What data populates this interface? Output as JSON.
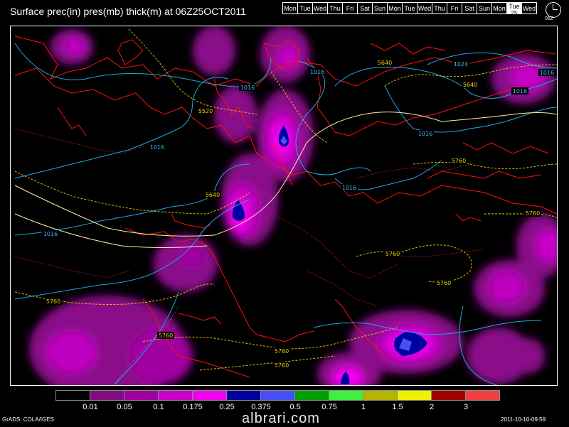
{
  "title": "Surface prec(in) pres(mb) thick(m) at 06Z25OCT2011",
  "days": [
    "Mon",
    "Tue",
    "Wed",
    "Thu",
    "Fri",
    "Sat",
    "Sun",
    "Mon",
    "Tue",
    "Wed",
    "Thu",
    "Fri",
    "Sat",
    "Sun",
    "Mon",
    "Tue",
    "Wed"
  ],
  "current_day_index": 15,
  "current_day_number": "25",
  "clock_label": "06Z",
  "legend": {
    "colors": [
      "#000000",
      "#7f0f7f",
      "#a000a0",
      "#c800c8",
      "#f000f0",
      "#0000a0",
      "#4650f5",
      "#00a000",
      "#40f040",
      "#b4b400",
      "#f0f000",
      "#a00000",
      "#f04040"
    ],
    "labels": [
      "0.01",
      "0.05",
      "0.1",
      "0.175",
      "0.25",
      "0.375",
      "0.5",
      "0.75",
      "1",
      "1.5",
      "2",
      "3"
    ]
  },
  "contour_labels": {
    "pressure": [
      "1016",
      "1016",
      "1016",
      "1016",
      "1016",
      "1016",
      "1024",
      "1016",
      "1016"
    ],
    "thickness": [
      "5520",
      "5640",
      "5640",
      "5640",
      "5760",
      "5760",
      "5760",
      "5760",
      "5760",
      "5760",
      "5760",
      "5760"
    ]
  },
  "footer": {
    "grads": "GrADS: COLA/IGES",
    "timestamp": "2011-10-10-09:59",
    "watermark": "albrari.com"
  }
}
